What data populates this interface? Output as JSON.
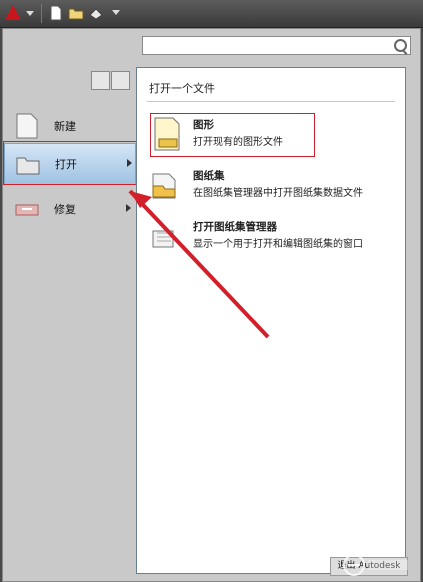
{
  "menu": {
    "left": [
      {
        "label": "新建"
      },
      {
        "label": "打开"
      },
      {
        "label": "修复"
      }
    ]
  },
  "panel": {
    "title": "打开一个文件",
    "entries": [
      {
        "title": "图形",
        "desc": "打开现有的图形文件"
      },
      {
        "title": "图纸集",
        "desc": "在图纸集管理器中打开图纸集数据文件"
      },
      {
        "title": "打开图纸集管理器",
        "desc": "显示一个用于打开和编辑图纸集的窗口"
      }
    ],
    "exit_button": "退出 Autodesk"
  },
  "icons": {
    "app": "autocad-logo-icon",
    "new": "new-document-icon",
    "open": "open-folder-icon",
    "repair": "repair-icon",
    "search": "search-icon"
  },
  "colors": {
    "highlight": "#d21f2a",
    "selected_bg": "#b7d2ec"
  }
}
